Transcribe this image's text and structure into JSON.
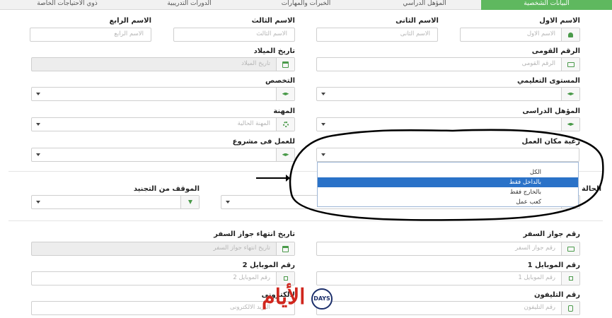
{
  "tabs": [
    {
      "label": "البيانات الشخصية",
      "active": true
    },
    {
      "label": "المؤهل الدراسي",
      "active": false
    },
    {
      "label": "الخبرات والمهارات",
      "active": false
    },
    {
      "label": "الدورات التدريبية",
      "active": false
    },
    {
      "label": "ذوي الاحتياجات الخاصة",
      "active": false
    }
  ],
  "form": {
    "first_name": {
      "label": "الاسم الاول",
      "placeholder": "الاسم الاول",
      "icon": "user-icon"
    },
    "second_name": {
      "label": "الاسم الثانى",
      "placeholder": "الاسم الثانى"
    },
    "third_name": {
      "label": "الاسم الثالث",
      "placeholder": "الاسم الثالث"
    },
    "fourth_name": {
      "label": "الاسم الرابع",
      "placeholder": "الاسم الرابع"
    },
    "national_id": {
      "label": "الرقم القومى",
      "placeholder": "الرقم القومى",
      "icon": "id-card-icon"
    },
    "birth_date": {
      "label": "تاريخ الميلاد",
      "placeholder": "تاريخ الميلاد",
      "icon": "calendar-icon"
    },
    "education_level": {
      "label": "المستوى التعليمي",
      "icon": "graduation-cap-icon"
    },
    "specialization": {
      "label": "التخصص",
      "icon": "graduation-cap-icon"
    },
    "qualification": {
      "label": "المؤهل الدراسى",
      "icon": "graduation-cap-icon"
    },
    "occupation": {
      "label": "المهنة",
      "placeholder": "المهنة الحالية",
      "icon": "cog-icon"
    },
    "work_place": {
      "label": "رغبة مكان العمل",
      "options": [
        "الكل",
        "بالداخل فقط",
        "بالخارج فقط",
        "كعب عمل"
      ],
      "highlighted_index": 1
    },
    "project_work": {
      "label": "للعمل فى مشروع",
      "icon": "graduation-cap-icon"
    },
    "marital_status": {
      "label": "الحالة ا"
    },
    "military_status": {
      "label": "الموقف من التجنيد",
      "icon": "download-icon"
    },
    "passport_no": {
      "label": "رقم جواز السفر",
      "placeholder": "رقم جواز السفر",
      "icon": "id-card-icon"
    },
    "passport_expiry": {
      "label": "تاريخ انتهاء جواز السفر",
      "placeholder": "تاريخ انتهاء جواز السفر",
      "icon": "calendar-icon"
    },
    "mobile_1": {
      "label": "رقم الموبايل 1",
      "placeholder": "رقم الموبايل 1"
    },
    "mobile_2": {
      "label": "رقم الموبايل 2",
      "placeholder": "رقم الموبايل 2"
    },
    "phone": {
      "label": "رقم التليفون",
      "placeholder": "رقم التليفون",
      "icon": "phone-icon"
    },
    "email": {
      "label": "البريد الالكترونى",
      "label_visible": "لالكترونى",
      "placeholder": "البريد الالكترونى"
    }
  },
  "watermark": {
    "text": "الأيام",
    "badge": "DAYS",
    "color": "#d0261d"
  },
  "annotation": {
    "arrow_color": "#000000",
    "circle_color": "#000000"
  }
}
